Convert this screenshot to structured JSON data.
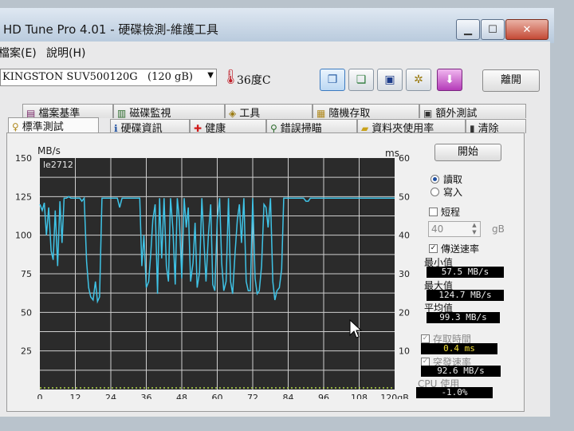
{
  "window": {
    "title": "HD Tune Pro 4.01 - 硬碟檢測-維護工具",
    "caption_buttons": {
      "minimize": "▁",
      "maximize": "☐",
      "close": "✕"
    }
  },
  "menu": {
    "file": "檔案(E)",
    "help": "說明(H)"
  },
  "toolbar": {
    "drive": "KINGSTON SUV500120G",
    "drive_size": "(120 gB)",
    "temperature": "36度C",
    "exit_label": "離開",
    "icons": [
      "copy-text-icon",
      "copy-screenshot-icon",
      "save-icon",
      "options-icon",
      "download-icon"
    ]
  },
  "tabs_top": [
    "檔案基準",
    "磁碟監視",
    "工具",
    "隨機存取",
    "額外測試"
  ],
  "tabs_bottom": [
    "標準測試",
    "硬碟資訊",
    "健康",
    "錯誤掃瞄",
    "資料夾使用率",
    "清除"
  ],
  "active_tab": "標準測試",
  "controls": {
    "start_label": "開始",
    "read_label": "讀取",
    "write_label": "寫入",
    "mode": "讀取",
    "short_label": "短程",
    "short_value": "40",
    "short_unit": "gB",
    "transfer_label": "傳送速率",
    "min_label": "最小值",
    "min_value": "57.5 MB/s",
    "max_label": "最大值",
    "max_value": "124.7 MB/s",
    "avg_label": "平均值",
    "avg_value": "99.3 MB/s",
    "access_label": "存取時間",
    "access_value": "0.4 ms",
    "burst_label": "突發速率",
    "burst_value": "92.6 MB/s",
    "cpu_label": "CPU 使用",
    "cpu_value": "-1.0%"
  },
  "chart_data": {
    "type": "line",
    "watermark": "le2712",
    "y_left_unit": "MB/s",
    "y_right_unit": "ms",
    "x_unit": "gB",
    "xlim": [
      0,
      120
    ],
    "ylim_left": [
      0,
      150
    ],
    "ylim_right": [
      0,
      60
    ],
    "x_ticks": [
      "0",
      "12",
      "24",
      "36",
      "48",
      "60",
      "72",
      "84",
      "96",
      "108",
      "120gB"
    ],
    "y_left_ticks": [
      "150",
      "125",
      "100",
      "75",
      "50",
      "25"
    ],
    "y_right_ticks": [
      "60",
      "50",
      "40",
      "30",
      "20",
      "10"
    ],
    "grid": true,
    "line_color": "#3fc3e6",
    "series": [
      {
        "x": [
          0,
          0.8,
          1.5,
          2.2,
          3.0,
          3.8,
          4.5,
          5.2,
          6.0,
          6.8,
          7.5,
          8.2,
          9.0,
          9.8,
          10.5,
          11.2,
          12.0,
          12.8,
          13.5,
          14.2,
          15.0,
          15.8,
          16.5,
          17.2,
          18.0,
          18.8,
          19.5,
          20.2,
          21.0,
          21.8,
          22.5,
          23.2,
          24.0,
          24.8,
          25.5,
          26.2,
          27.0,
          27.8,
          28.5,
          29.2,
          30.0,
          30.8,
          31.5,
          32.2,
          33.0,
          33.8,
          34.5,
          35.2,
          36.0,
          36.8,
          37.5,
          38.2,
          39.0,
          39.8,
          40.5,
          41.2,
          42.0,
          42.8,
          43.5,
          44.2,
          45.0,
          45.8,
          46.5,
          47.2,
          48.0,
          48.8,
          49.5,
          50.2,
          51.0,
          51.8,
          52.5,
          53.2,
          54.0,
          54.8,
          55.5,
          56.2,
          57.0,
          57.8,
          58.5,
          59.2,
          60.0,
          60.8,
          61.5,
          62.2,
          63.0,
          63.8,
          64.5,
          65.2,
          66.0,
          66.8,
          67.5,
          68.2,
          69.0,
          69.8,
          70.5,
          71.2,
          72.0,
          72.8,
          73.5,
          74.2,
          75.0,
          75.8,
          76.5,
          77.2,
          78.0,
          78.8,
          79.5,
          80.2,
          81.0,
          81.8,
          82.5,
          83.2,
          84.0,
          84.8,
          85.5,
          86.2,
          87.0,
          87.8,
          88.5,
          89.2,
          90.0,
          90.8,
          91.5,
          92.2,
          93.0,
          93.8,
          94.5,
          95.2,
          96.0,
          96.8,
          97.5,
          98.2,
          99.0,
          99.8,
          100.5,
          101.2,
          102.0,
          102.8,
          103.5,
          104.2,
          105.0,
          105.8,
          106.5,
          107.2,
          108.0,
          108.8,
          109.5,
          110.2,
          111.0,
          111.8,
          112.5,
          113.2,
          114.0,
          114.8,
          115.5,
          116.2,
          117.0,
          117.8,
          118.5,
          119.2,
          120.0
        ],
        "y": [
          120,
          116,
          121,
          100,
          118,
          90,
          84,
          116,
          80,
          122,
          95,
          124,
          124,
          125,
          124,
          124,
          124,
          124,
          124,
          122,
          124,
          83,
          66,
          60,
          58,
          70,
          57,
          60,
          124,
          124,
          124,
          124,
          124,
          124,
          124,
          124,
          118,
          124,
          124,
          124,
          124,
          124,
          124,
          124,
          124,
          124,
          80,
          100,
          66,
          70,
          88,
          110,
          120,
          62,
          124,
          85,
          124,
          80,
          70,
          124,
          104,
          68,
          124,
          110,
          72,
          124,
          105,
          118,
          70,
          82,
          108,
          66,
          76,
          124,
          96,
          70,
          100,
          120,
          68,
          64,
          110,
          124,
          82,
          64,
          70,
          124,
          70,
          62,
          88,
          110,
          120,
          95,
          124,
          70,
          64,
          64,
          124,
          72,
          62,
          64,
          80,
          120,
          118,
          105,
          124,
          70,
          58,
          64,
          66,
          78,
          124,
          124,
          124,
          124,
          124,
          124,
          124,
          124,
          124,
          124,
          122,
          122,
          124,
          124,
          124,
          124,
          124,
          124,
          124,
          124,
          124,
          124,
          124,
          124,
          124,
          124,
          124,
          124,
          124,
          124,
          124,
          124,
          124,
          124,
          124,
          124,
          124,
          124,
          124,
          124,
          124,
          124,
          124,
          124,
          124,
          124,
          124,
          124,
          124,
          124,
          124
        ]
      }
    ]
  },
  "colors": {
    "plot_bg": "#2b2b2b",
    "grid": "#cfcfcf",
    "readout_bg": "#000000",
    "access_text": "#f5e23a"
  }
}
